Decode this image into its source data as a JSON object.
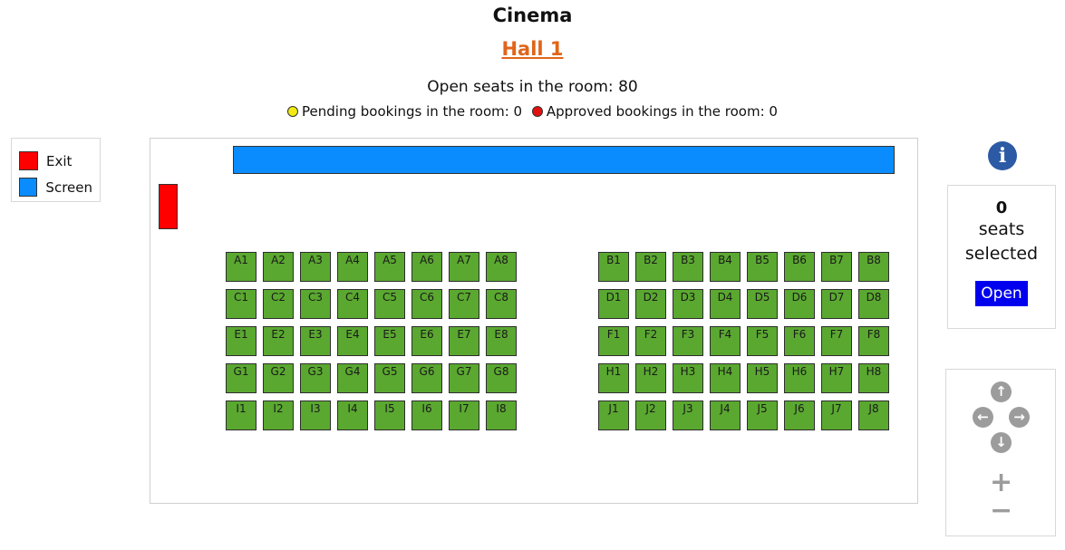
{
  "header": {
    "title": "Cinema",
    "hall": "Hall 1",
    "open_seats": "Open seats in the room: 80",
    "pending": "Pending bookings in the room: 0",
    "approved": "Approved bookings in the room: 0"
  },
  "colors": {
    "pending_dot": "#f2ea10",
    "approved_dot": "#e31010",
    "exit": "#ff0000",
    "screen": "#0a8cff",
    "seat_available": "#5aa830",
    "info_icon": "#2d5aa5",
    "open_button": "#0000ee"
  },
  "legend": [
    {
      "label": "Exit",
      "color": "#ff0000"
    },
    {
      "label": "Screen",
      "color": "#0a8cff"
    }
  ],
  "seat_blocks": [
    {
      "side": "left",
      "rows": [
        "A",
        "C",
        "E",
        "G",
        "I"
      ]
    },
    {
      "side": "right",
      "rows": [
        "B",
        "D",
        "F",
        "H",
        "J"
      ]
    }
  ],
  "seats_per_row": 8,
  "seat_status": "available",
  "selection": {
    "count": "0",
    "label_line1": "seats",
    "label_line2": "selected",
    "open_button": "Open"
  },
  "nav": {
    "up": "↑",
    "left": "←",
    "right": "→",
    "down": "↓",
    "zoom_in": "+",
    "zoom_out": "−"
  },
  "icons": {
    "info": "i"
  }
}
